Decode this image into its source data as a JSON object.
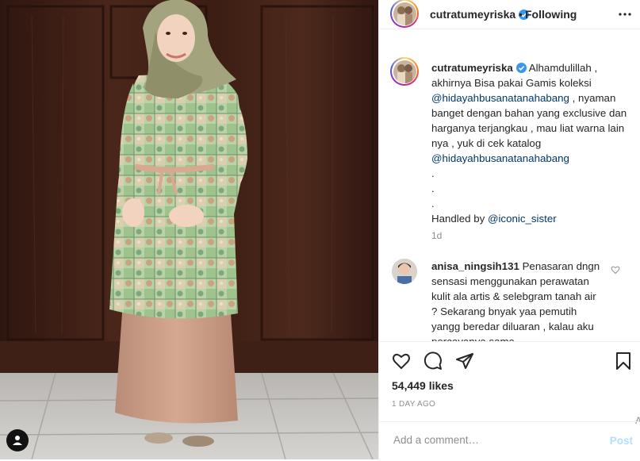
{
  "post": {
    "photo_alt": "",
    "author": "cutratumeyriska",
    "separator": "•",
    "follow_status": "Following"
  },
  "caption": {
    "username": "cutratumeyriska",
    "text_1": "Alhamdulillah , akhirnya Bisa pakai Gamis koleksi",
    "mention_1": "@hidayahbusanatanahabang",
    "text_2": ", nyaman banget dengan bahan yang exclusive dan harganya terjangkau , mau liat warna lain nya , yuk di cek katalog",
    "mention_2": "@hidayahbusanatanahabang",
    "dot": ".",
    "handled_label": "Handled by",
    "mention_3": "@iconic_sister",
    "time": "1d"
  },
  "comment_2": {
    "username": "anisa_ningsih131",
    "text": "Penasaran dngn sensasi menggunakan perawatan kulit ala artis & selebgram tanah air ? Sekarang bnyak yaa pemutih yangg beredar diluaran , kalau aku percayanya sama"
  },
  "stats": {
    "likes": "54,449 likes",
    "date": "1 DAY AGO"
  },
  "composer": {
    "placeholder": "Add a comment…",
    "post_label": "Post",
    "edge_char": "A"
  },
  "colors": {
    "link": "#00376b",
    "verified": "#3897f0",
    "muted": "#8e8e8e",
    "post_disabled": "#b2dffc"
  },
  "icons": [
    "user-tag-icon",
    "verified-icon",
    "more-options-icon",
    "heart-icon",
    "comment-icon",
    "share-icon",
    "bookmark-icon"
  ]
}
